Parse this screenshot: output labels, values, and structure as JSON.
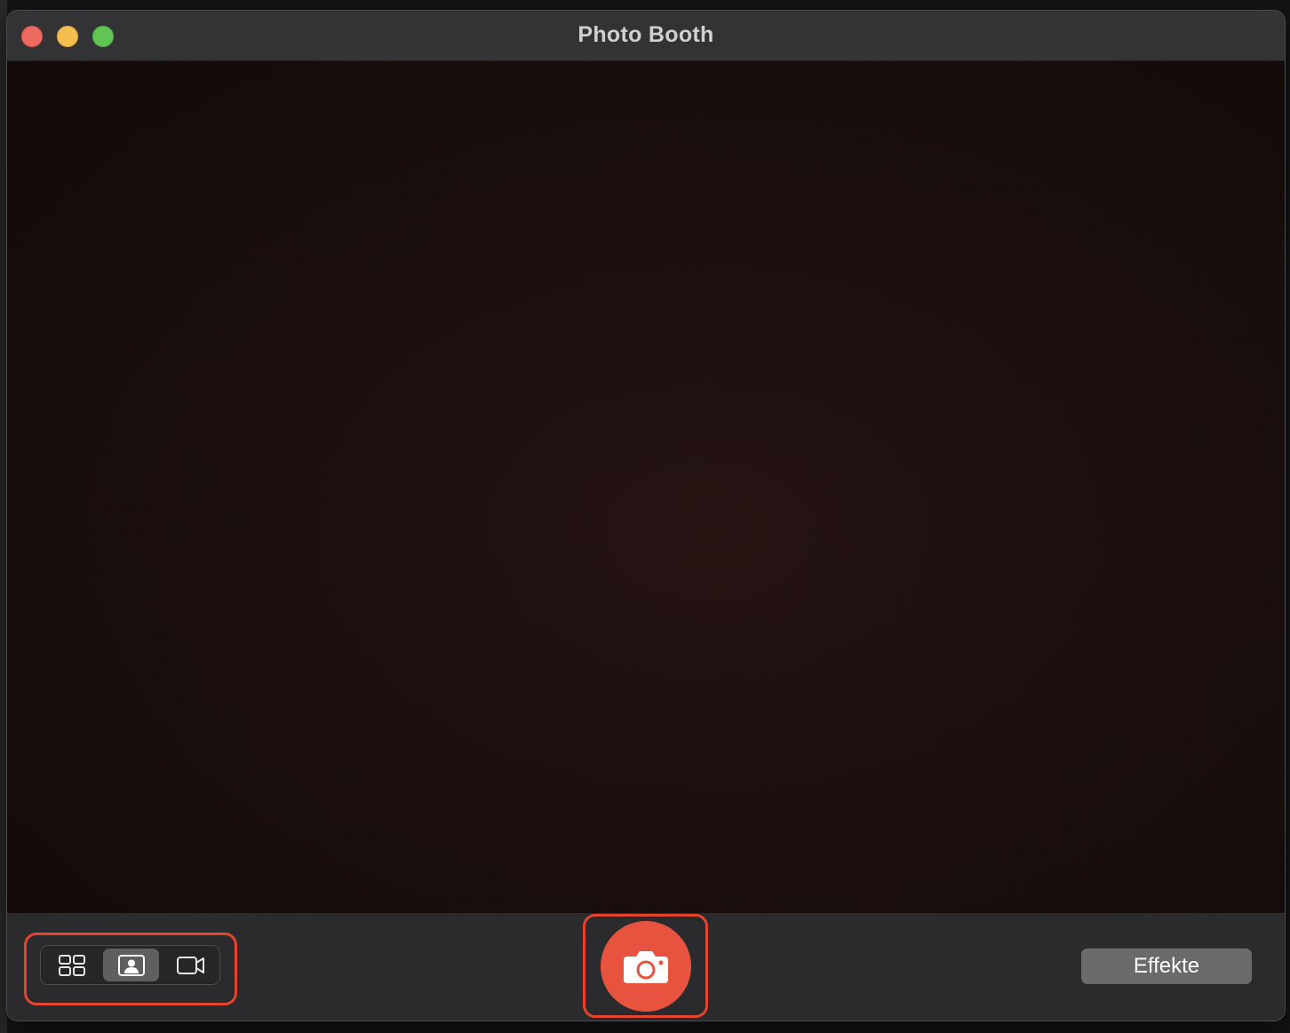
{
  "window": {
    "title": "Photo Booth",
    "buttons": [
      "close",
      "minimize",
      "zoom"
    ]
  },
  "toolbar": {
    "mode_selector": {
      "options": [
        {
          "icon": "four-photo-grid-icon",
          "selected": false
        },
        {
          "icon": "single-photo-portrait-icon",
          "selected": true
        },
        {
          "icon": "video-camera-icon",
          "selected": false
        }
      ]
    },
    "shutter": {
      "icon": "camera-icon"
    },
    "effects_label": "Effekte"
  },
  "colors": {
    "shutter": "#e8533f",
    "highlight": "#e5432d",
    "selected_segment": "#5f5f62",
    "effects_button": "#6a6a6d"
  }
}
